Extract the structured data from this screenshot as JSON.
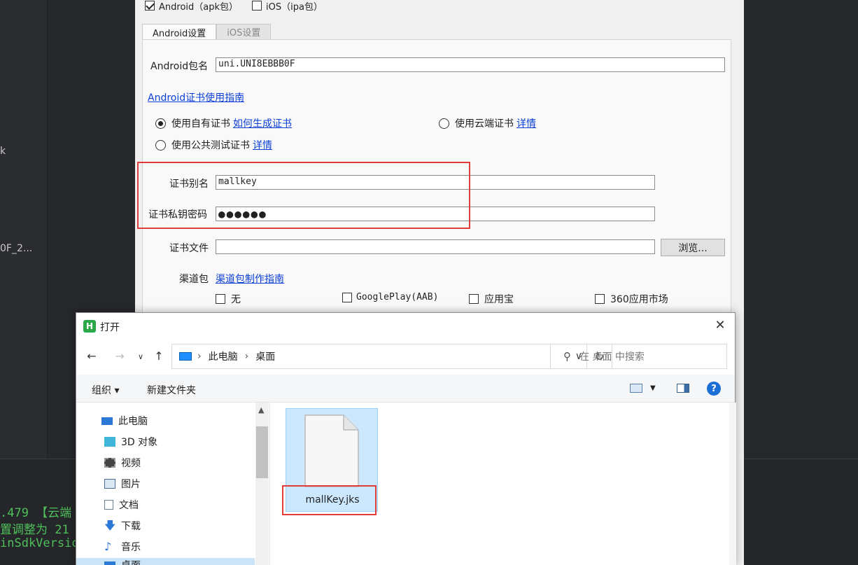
{
  "background": {
    "sidebar_fragments": [
      "k",
      "0F_2..."
    ],
    "console_lines": [
      ".479 【云端",
      "置调整为 21",
      "inSdkVersio"
    ]
  },
  "config": {
    "platforms": [
      {
        "label": "Android（apk包）",
        "checked": true
      },
      {
        "label": "iOS（ipa包）",
        "checked": false
      }
    ],
    "tabs": [
      {
        "label": "Android设置",
        "active": true
      },
      {
        "label": "iOS设置",
        "active": false
      }
    ],
    "package_name_label": "Android包名",
    "package_name_value": "uni.UNI8EBBB0F",
    "cert_guide_link": "Android证书使用指南",
    "cert_options": {
      "own": {
        "label": "使用自有证书",
        "link": "如何生成证书",
        "selected": true
      },
      "cloud": {
        "label": "使用云端证书",
        "link": "详情",
        "selected": false
      },
      "public": {
        "label": "使用公共测试证书",
        "link": "详情",
        "selected": false
      }
    },
    "alias_label": "证书别名",
    "alias_value": "mallkey",
    "password_label": "证书私钥密码",
    "password_value": "●●●●●●",
    "cert_file_label": "证书文件",
    "cert_file_value": "",
    "browse_button": "浏览...",
    "channel_label": "渠道包",
    "channel_link": "渠道包制作指南",
    "channels": [
      {
        "label": "无",
        "checked": false
      },
      {
        "label": "GooglePlay(AAB)",
        "checked": false
      },
      {
        "label": "应用宝",
        "checked": false
      },
      {
        "label": "360应用市场",
        "checked": false
      }
    ]
  },
  "open_dialog": {
    "title": "打开",
    "logo": "H",
    "breadcrumb": [
      "此电脑",
      "桌面"
    ],
    "search_placeholder": "在 桌面 中搜索",
    "toolbar": {
      "organize": "组织 ▾",
      "new_folder": "新建文件夹",
      "help": "?"
    },
    "tree": [
      {
        "label": "此电脑",
        "icon": "computer-icon"
      },
      {
        "label": "3D 对象",
        "icon": "3d-objects-icon"
      },
      {
        "label": "视频",
        "icon": "video-icon"
      },
      {
        "label": "图片",
        "icon": "picture-icon"
      },
      {
        "label": "文档",
        "icon": "document-icon"
      },
      {
        "label": "下载",
        "icon": "download-icon"
      },
      {
        "label": "音乐",
        "icon": "music-icon"
      },
      {
        "label": "桌面",
        "icon": "desktop-icon",
        "selected": true
      }
    ],
    "files": [
      {
        "name": "mallKey.jks",
        "icon": "file-icon",
        "selected": true
      }
    ]
  },
  "colors": {
    "highlight_box": "#e03c3c",
    "link": "#0b3fd6",
    "selection": "#cce8ff",
    "console_text": "#4fbf5a"
  }
}
